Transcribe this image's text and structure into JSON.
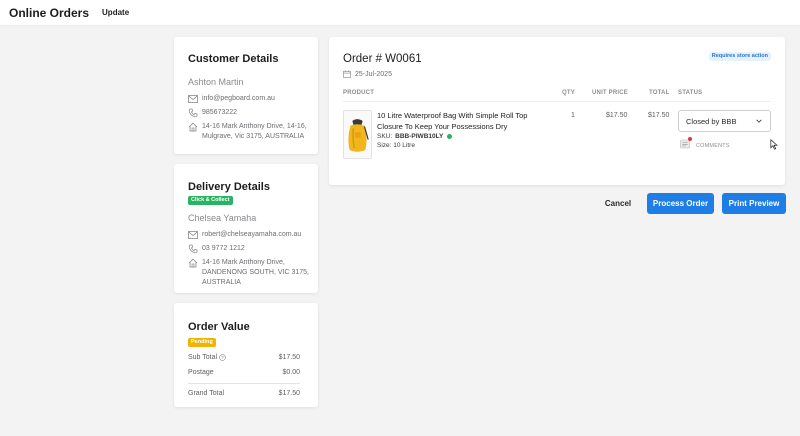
{
  "topbar": {
    "title": "Online Orders",
    "update": "Update"
  },
  "customer": {
    "heading": "Customer Details",
    "name": "Ashton Martin",
    "email": "info@pegboard.com.au",
    "phone": "985673222",
    "address": "14-16 Mark Anthony Drive, 14-16, Mulgrave, Vic 3175, AUSTRALIA"
  },
  "delivery": {
    "heading": "Delivery Details",
    "badge": "Click & Collect",
    "name": "Chelsea Yamaha",
    "email": "robert@chelseayamaha.com.au",
    "phone": "03 9772 1212",
    "address": "14-16 Mark Anthony Drive, DANDENONG SOUTH, VIC 3175, AUSTRALIA"
  },
  "order_value": {
    "heading": "Order Value",
    "badge": "Pending",
    "sub_total_label": "Sub Total",
    "sub_total": "$17.50",
    "postage_label": "Postage",
    "postage": "$0.00",
    "grand_total_label": "Grand Total",
    "grand_total": "$17.50"
  },
  "order": {
    "title": "Order # W0061",
    "date": "25-Jul-2025",
    "action_badge": "Requires store action",
    "columns": {
      "product": "PRODUCT",
      "qty": "QTY",
      "unit_price": "UNIT PRICE",
      "total": "TOTAL",
      "status": "STATUS"
    },
    "item": {
      "name": "10 Litre Waterproof Bag With Simple Roll Top Closure To Keep Your Possessions Dry",
      "sku_label": "SKU:",
      "sku": "BBB-PIWB10LY",
      "size": "Size: 10 Litre",
      "qty": "1",
      "unit_price": "$17.50",
      "total": "$17.50",
      "status": "Closed by BBB",
      "comments_label": "COMMENTS"
    }
  },
  "actions": {
    "cancel": "Cancel",
    "process": "Process Order",
    "print": "Print Preview"
  },
  "colors": {
    "primary": "#1f7ee6",
    "green": "#28b463",
    "amber": "#f1b400",
    "badge_blue_bg": "#e7f1fd",
    "badge_blue_text": "#2a73c9"
  }
}
